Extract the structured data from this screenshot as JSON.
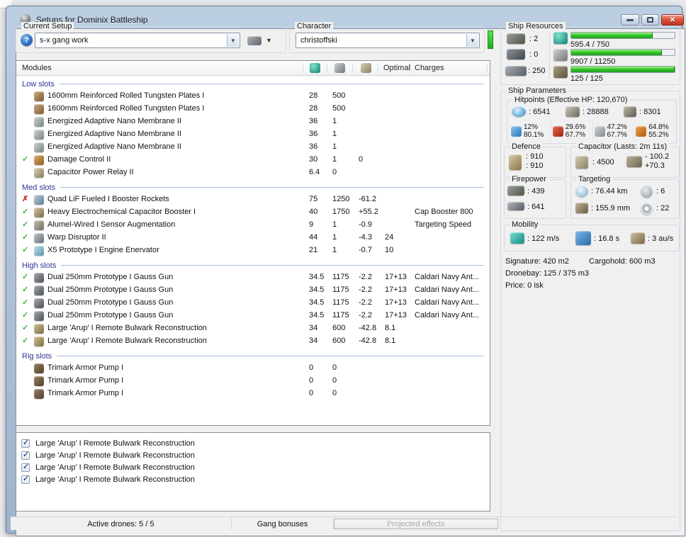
{
  "colors": {
    "character_status_green": "#2fd32f",
    "ok_check": "#3fae3f",
    "error_x": "#c62b20",
    "resource_bar_fill": "#35c929",
    "section_header_text": "#2d3494"
  },
  "window": {
    "title": "Setups for Dominix Battleship"
  },
  "setup_group": {
    "label": "Current Setup",
    "value": "s-x gang work"
  },
  "character_group": {
    "label": "Character",
    "value": "christoffski"
  },
  "ship_resources": {
    "title": "Ship Resources",
    "turret_hardpoints": ": 2",
    "launcher_hardpoints": ": 0",
    "calibration": ": 250",
    "cpu": {
      "text": "595.4 / 750",
      "pct": 79
    },
    "powergrid": {
      "text": "9907 / 11250",
      "pct": 88
    },
    "drone_bandwidth": {
      "text": "125 / 125",
      "pct": 100
    }
  },
  "ship_parameters": {
    "title": "Ship Parameters",
    "hitpoints": {
      "title": "Hitpoints (Effective HP: 120,670)",
      "shield": ": 6541",
      "armor": ": 28888",
      "structure": ": 8301",
      "resists": [
        {
          "type": "em",
          "shield": "12%",
          "armor": "80.1%"
        },
        {
          "type": "thermal",
          "shield": "29.6%",
          "armor": "67.7%"
        },
        {
          "type": "kinetic",
          "shield": "47.2%",
          "armor": "67.7%"
        },
        {
          "type": "explosive",
          "shield": "64.8%",
          "armor": "55.2%"
        }
      ]
    },
    "defence": {
      "title": "Defence",
      "value1": ": 910",
      "value2": ": 910"
    },
    "capacitor": {
      "title": "Capacitor (Lasts: 2m 11s)",
      "amount": ": 4500",
      "peak_out": "- 100.2",
      "peak_in": "+70.3"
    },
    "firepower": {
      "title": "Firepower",
      "volley": ": 439",
      "dps": ": 641"
    },
    "targeting": {
      "title": "Targeting",
      "range": ": 76.44 km",
      "max_targets": ": 6",
      "scan_resolution": ": 155.9 mm",
      "sensor_strength": ": 22"
    },
    "mobility": {
      "title": "Mobility",
      "max_velocity": ": 122 m/s",
      "align_time": ": 16.8 s",
      "warp_speed": ": 3 au/s"
    },
    "signature": "Signature: 420 m2",
    "cargohold": "Cargohold: 600 m3",
    "dronebay": "Dronebay: 125 / 375 m3",
    "price": "Price: 0 isk"
  },
  "modules_table": {
    "header": {
      "modules": "Modules",
      "optimal": "Optimal",
      "charges": "Charges"
    },
    "sections": [
      {
        "label": "Low slots",
        "rows": [
          {
            "status": "",
            "icon": "armor-plate",
            "name": "1600mm Reinforced Rolled Tungsten Plates I",
            "cpu": "28",
            "pg": "500",
            "cap": "",
            "optimal": "",
            "charges": ""
          },
          {
            "status": "",
            "icon": "armor-plate",
            "name": "1600mm Reinforced Rolled Tungsten Plates I",
            "cpu": "28",
            "pg": "500",
            "cap": "",
            "optimal": "",
            "charges": ""
          },
          {
            "status": "",
            "icon": "nano-membrane",
            "name": "Energized Adaptive Nano Membrane II",
            "cpu": "36",
            "pg": "1",
            "cap": "",
            "optimal": "",
            "charges": ""
          },
          {
            "status": "",
            "icon": "nano-membrane",
            "name": "Energized Adaptive Nano Membrane II",
            "cpu": "36",
            "pg": "1",
            "cap": "",
            "optimal": "",
            "charges": ""
          },
          {
            "status": "",
            "icon": "nano-membrane",
            "name": "Energized Adaptive Nano Membrane II",
            "cpu": "36",
            "pg": "1",
            "cap": "",
            "optimal": "",
            "charges": ""
          },
          {
            "status": "ok",
            "icon": "damage-control",
            "name": "Damage Control II",
            "cpu": "30",
            "pg": "1",
            "cap": "0",
            "optimal": "",
            "charges": ""
          },
          {
            "status": "",
            "icon": "cap-relay",
            "name": "Capacitor Power Relay II",
            "cpu": "6.4",
            "pg": "0",
            "cap": "",
            "optimal": "",
            "charges": ""
          }
        ]
      },
      {
        "label": "Med slots",
        "rows": [
          {
            "status": "error",
            "icon": "booster-rockets",
            "name": "Quad LiF Fueled I Booster Rockets",
            "cpu": "75",
            "pg": "1250",
            "cap": "-61.2",
            "optimal": "",
            "charges": ""
          },
          {
            "status": "ok",
            "icon": "cap-booster",
            "name": "Heavy Electrochemical Capacitor Booster I",
            "cpu": "40",
            "pg": "1750",
            "cap": "+55.2",
            "optimal": "",
            "charges": "Cap Booster 800"
          },
          {
            "status": "ok",
            "icon": "sensor-augmentation",
            "name": "Alumel-Wired I Sensor Augmentation",
            "cpu": "9",
            "pg": "1",
            "cap": "-0.9",
            "optimal": "",
            "charges": "Targeting Speed"
          },
          {
            "status": "ok",
            "icon": "warp-disruptor",
            "name": "Warp Disruptor II",
            "cpu": "44",
            "pg": "1",
            "cap": "-4.3",
            "optimal": "24",
            "charges": ""
          },
          {
            "status": "ok",
            "icon": "stasis-web",
            "name": "X5 Prototype I Engine Enervator",
            "cpu": "21",
            "pg": "1",
            "cap": "-0.7",
            "optimal": "10",
            "charges": ""
          }
        ]
      },
      {
        "label": "High slots",
        "rows": [
          {
            "status": "ok",
            "icon": "gauss-gun",
            "name": "Dual 250mm Prototype I Gauss Gun",
            "cpu": "34.5",
            "pg": "1175",
            "cap": "-2.2",
            "optimal": "17+13",
            "charges": "Caldari Navy Ant..."
          },
          {
            "status": "ok",
            "icon": "gauss-gun",
            "name": "Dual 250mm Prototype I Gauss Gun",
            "cpu": "34.5",
            "pg": "1175",
            "cap": "-2.2",
            "optimal": "17+13",
            "charges": "Caldari Navy Ant..."
          },
          {
            "status": "ok",
            "icon": "gauss-gun",
            "name": "Dual 250mm Prototype I Gauss Gun",
            "cpu": "34.5",
            "pg": "1175",
            "cap": "-2.2",
            "optimal": "17+13",
            "charges": "Caldari Navy Ant..."
          },
          {
            "status": "ok",
            "icon": "gauss-gun",
            "name": "Dual 250mm Prototype I Gauss Gun",
            "cpu": "34.5",
            "pg": "1175",
            "cap": "-2.2",
            "optimal": "17+13",
            "charges": "Caldari Navy Ant..."
          },
          {
            "status": "ok",
            "icon": "remote-repair",
            "name": "Large 'Arup' I Remote Bulwark Reconstruction",
            "cpu": "34",
            "pg": "600",
            "cap": "-42.8",
            "optimal": "8.1",
            "charges": ""
          },
          {
            "status": "ok",
            "icon": "remote-repair",
            "name": "Large 'Arup' I Remote Bulwark Reconstruction",
            "cpu": "34",
            "pg": "600",
            "cap": "-42.8",
            "optimal": "8.1",
            "charges": ""
          }
        ]
      },
      {
        "label": "Rig slots",
        "rows": [
          {
            "status": "",
            "icon": "armor-rig",
            "name": "Trimark Armor Pump I",
            "cpu": "0",
            "pg": "0",
            "cap": "",
            "optimal": "",
            "charges": ""
          },
          {
            "status": "",
            "icon": "armor-rig",
            "name": "Trimark Armor Pump I",
            "cpu": "0",
            "pg": "0",
            "cap": "",
            "optimal": "",
            "charges": ""
          },
          {
            "status": "",
            "icon": "armor-rig",
            "name": "Trimark Armor Pump I",
            "cpu": "0",
            "pg": "0",
            "cap": "",
            "optimal": "",
            "charges": ""
          }
        ]
      }
    ]
  },
  "drones_panel": {
    "items": [
      {
        "checked": true,
        "label": "Large 'Arup' I Remote Bulwark Reconstruction"
      },
      {
        "checked": true,
        "label": "Large 'Arup' I Remote Bulwark Reconstruction"
      },
      {
        "checked": true,
        "label": "Large 'Arup' I Remote Bulwark Reconstruction"
      },
      {
        "checked": true,
        "label": "Large 'Arup' I Remote Bulwark Reconstruction"
      }
    ]
  },
  "statusbar": {
    "active_drones": "Active drones: 5 / 5",
    "gang_bonuses": "Gang bonuses",
    "projected_effects": "Projected effects"
  }
}
